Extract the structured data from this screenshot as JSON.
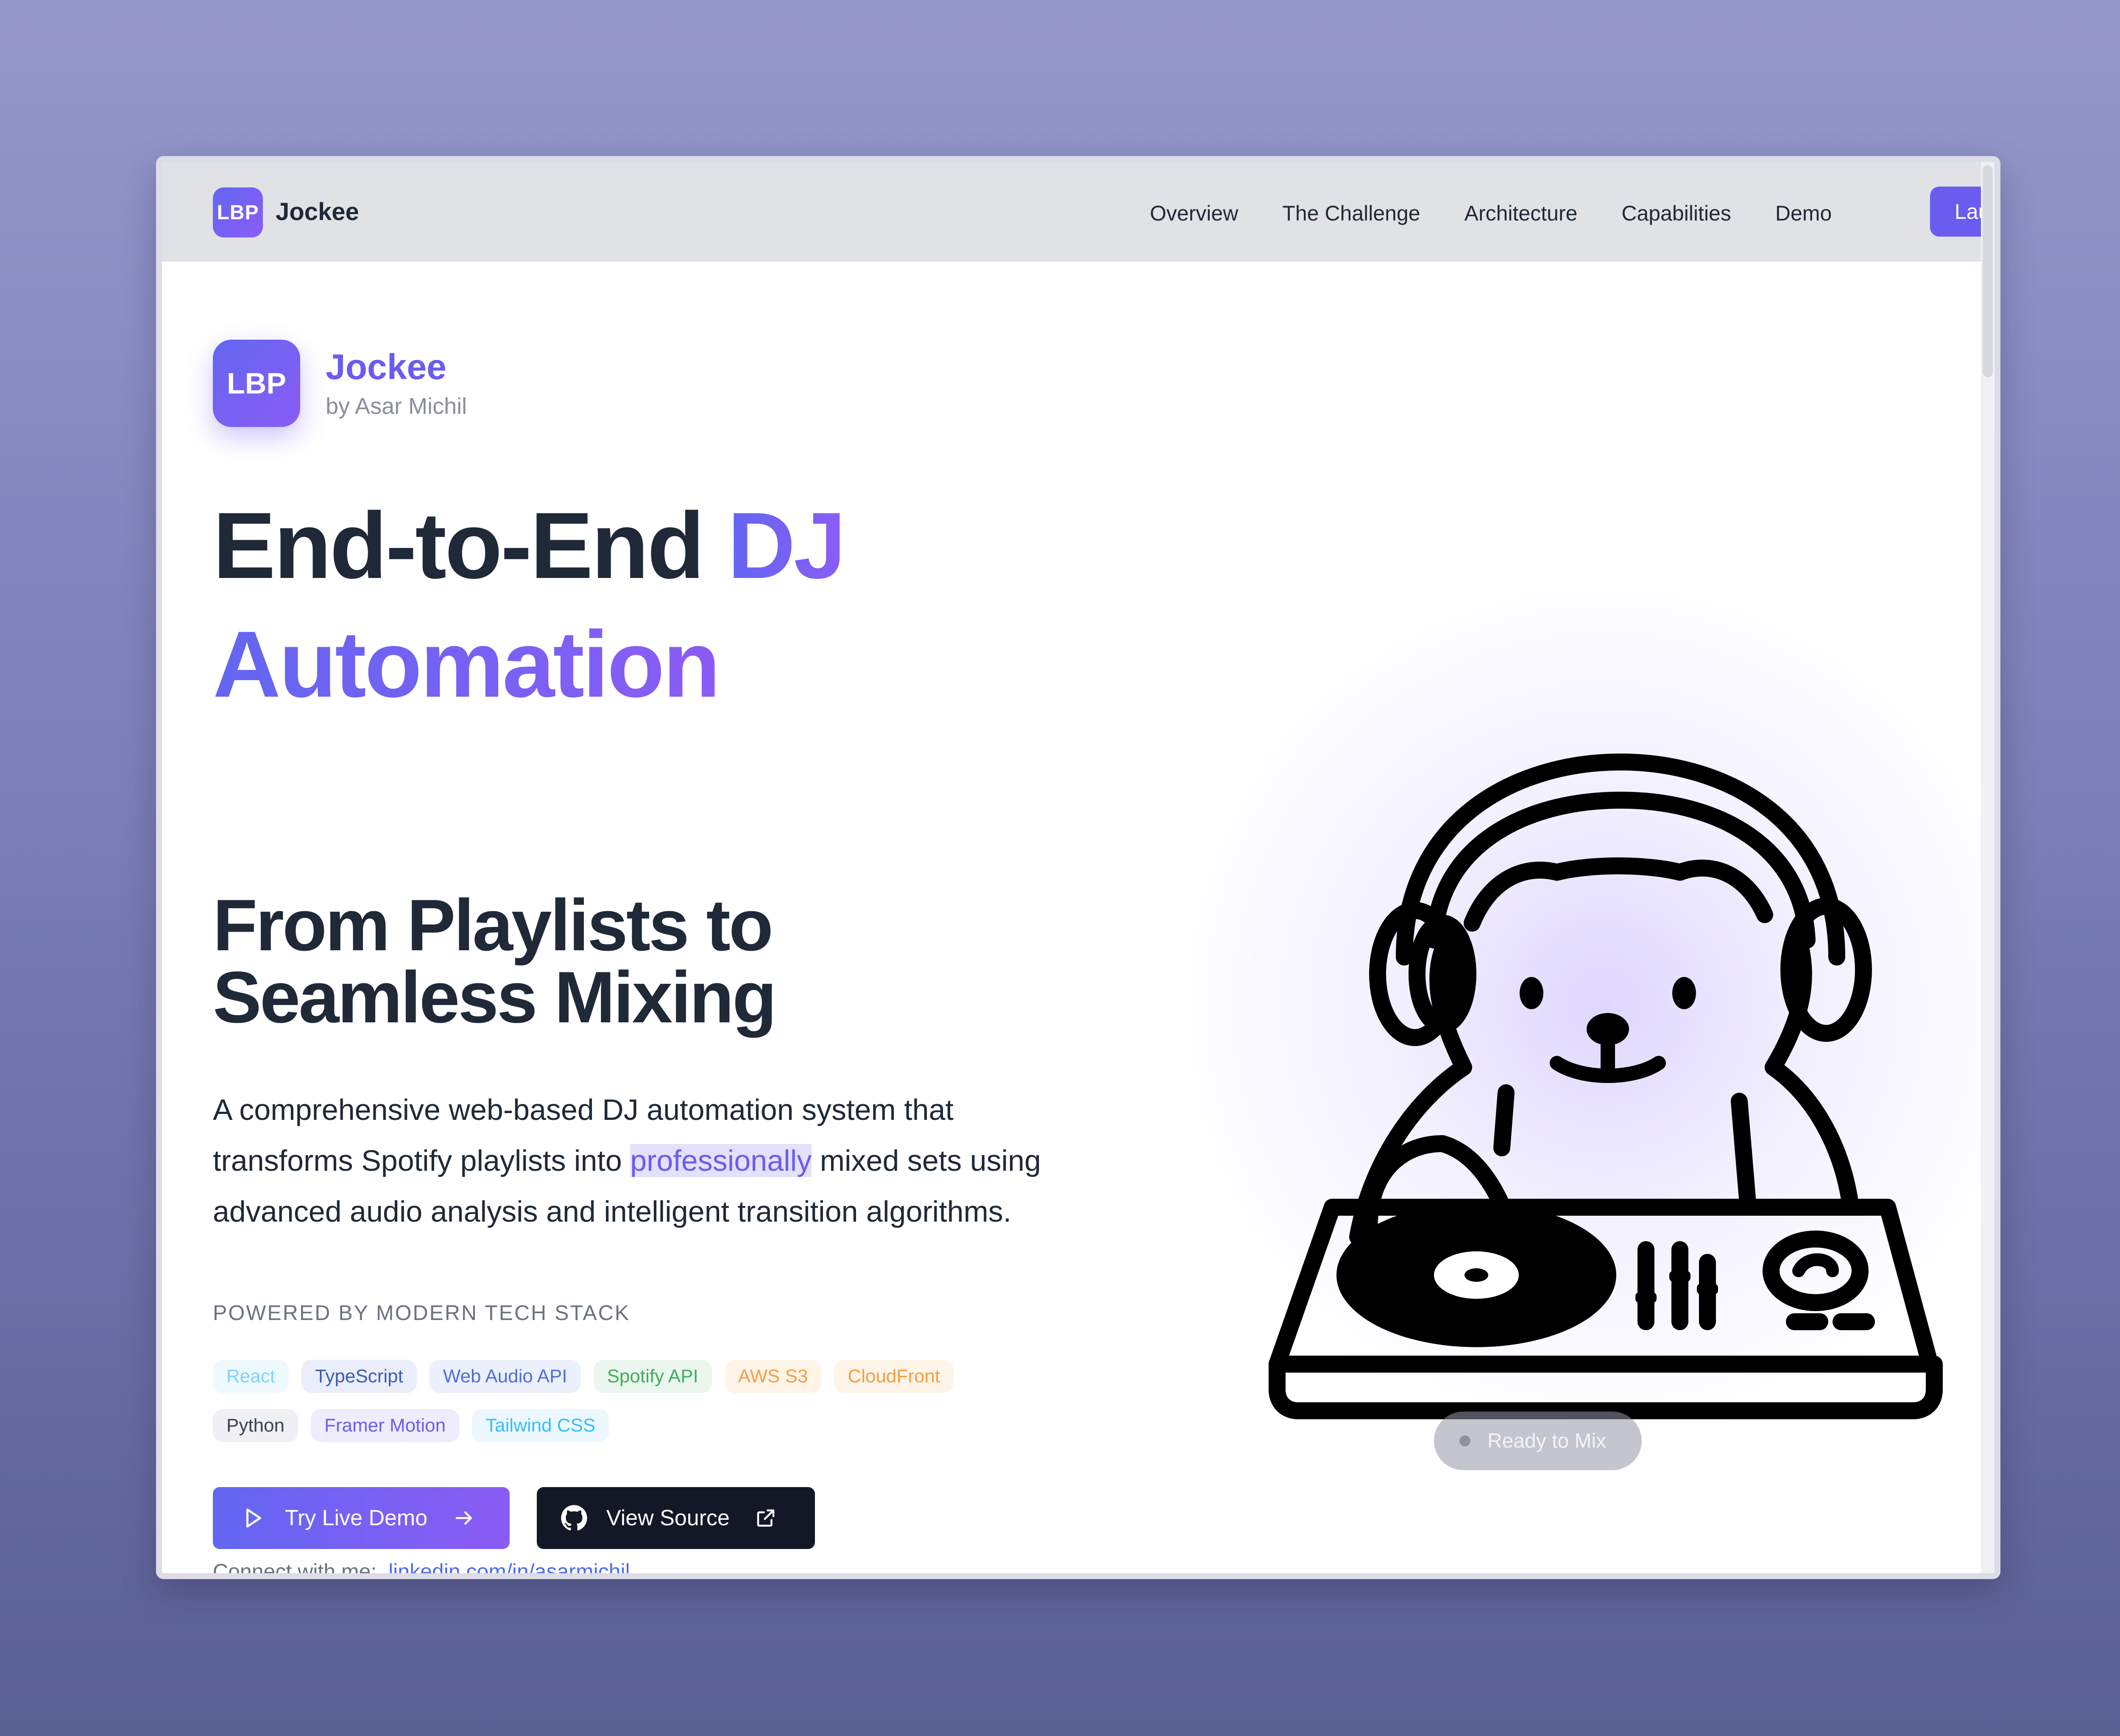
{
  "nav": {
    "logo_text": "LBP",
    "brand": "Jockee",
    "links": [
      "Overview",
      "The Challenge",
      "Architecture",
      "Capabilities",
      "Demo"
    ],
    "launch_label": "Launch App"
  },
  "hero": {
    "logo_text": "LBP",
    "brand": "Jockee",
    "author": "by Asar Michil",
    "headline_part1": "End-to-End ",
    "headline_accent1": "DJ",
    "headline_accent2": "Automation",
    "subheadline_line1": "From Playlists to",
    "subheadline_line2": "Seamless Mixing",
    "description_before": "A comprehensive web-based DJ automation system that transforms Spotify playlists into ",
    "description_highlight": "professionally",
    "description_after": " mixed sets using advanced audio analysis and intelligent transition algorithms."
  },
  "stack": {
    "label": "POWERED BY MODERN TECH STACK",
    "tags_row1": [
      {
        "label": "React",
        "color": "#7dd3fc",
        "bg": "#eef9fe"
      },
      {
        "label": "TypeScript",
        "color": "#3b5bb5",
        "bg": "#eaeefa"
      },
      {
        "label": "Web Audio API",
        "color": "#4f6fd6",
        "bg": "#eceffc"
      },
      {
        "label": "Spotify API",
        "color": "#3fae5a",
        "bg": "#eaf6ee"
      },
      {
        "label": "AWS S3",
        "color": "#f59e42",
        "bg": "#fef4e8"
      },
      {
        "label": "CloudFront",
        "color": "#f59e42",
        "bg": "#fef4e8"
      }
    ],
    "tags_row2": [
      {
        "label": "Python",
        "color": "#374151",
        "bg": "#eef0f3"
      },
      {
        "label": "Framer Motion",
        "color": "#6b5cf0",
        "bg": "#efedfd"
      },
      {
        "label": "Tailwind CSS",
        "color": "#38bdf8",
        "bg": "#ecf8fe"
      }
    ]
  },
  "actions": {
    "demo_label": "Try Live Demo",
    "source_label": "View Source"
  },
  "connect": {
    "label": "Connect with me:",
    "link": "linkedin.com/in/asarmichil"
  },
  "status": {
    "label": "Ready to Mix"
  },
  "icons": {
    "play": "play-icon",
    "arrow": "arrow-right-icon",
    "github": "github-icon",
    "external": "external-link-icon"
  },
  "colors": {
    "accent": "#6b5cf0",
    "accent_gradient_end": "#8b5cf6",
    "dark": "#1f2937",
    "source_button": "#121826"
  }
}
